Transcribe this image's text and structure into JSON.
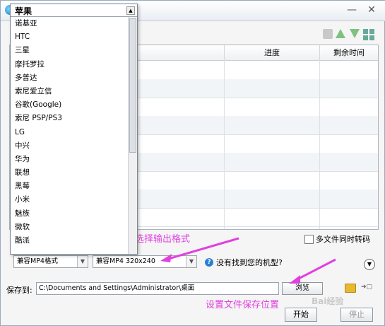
{
  "window": {
    "minimize_glyph": "—",
    "close_glyph": "✕"
  },
  "table": {
    "columns": [
      "称",
      "进度",
      "剩余时间"
    ]
  },
  "device_dropdown": {
    "selected": "苹果",
    "items": [
      "诺基亚",
      "HTC",
      "三星",
      "摩托罗拉",
      "多普达",
      "索尼爱立信",
      "谷歌(Google)",
      "索尼 PSP/PS3",
      "LG",
      "中兴",
      "华为",
      "联想",
      "黑莓",
      "小米",
      "魅族",
      "微软",
      "酷派"
    ]
  },
  "options": {
    "multi_convert_label": "多文件同时转码",
    "format_select": "兼容MP4格式",
    "resolution_select": "兼容MP4 320x240",
    "help_text": "没有找到您的机型?"
  },
  "save": {
    "label": "保存到:",
    "path": "C:\\Documents and Settings\\Administrator\\桌面",
    "browse_label": "浏览"
  },
  "actions": {
    "start_label": "开始",
    "stop_label": "停止"
  },
  "annotations": {
    "format_hint": "选择输出格式",
    "save_hint": "设置文件保存位置"
  },
  "colors": {
    "annotation": "#e040e0",
    "help_icon": "#2a7fd4"
  },
  "icons": [
    "app-icon",
    "minimize-icon",
    "close-icon",
    "trash-icon",
    "move-up-icon",
    "move-down-icon",
    "grid-icon",
    "help-icon",
    "expand-icon",
    "folder-icon",
    "export-icon"
  ],
  "watermark": "Bai经验"
}
